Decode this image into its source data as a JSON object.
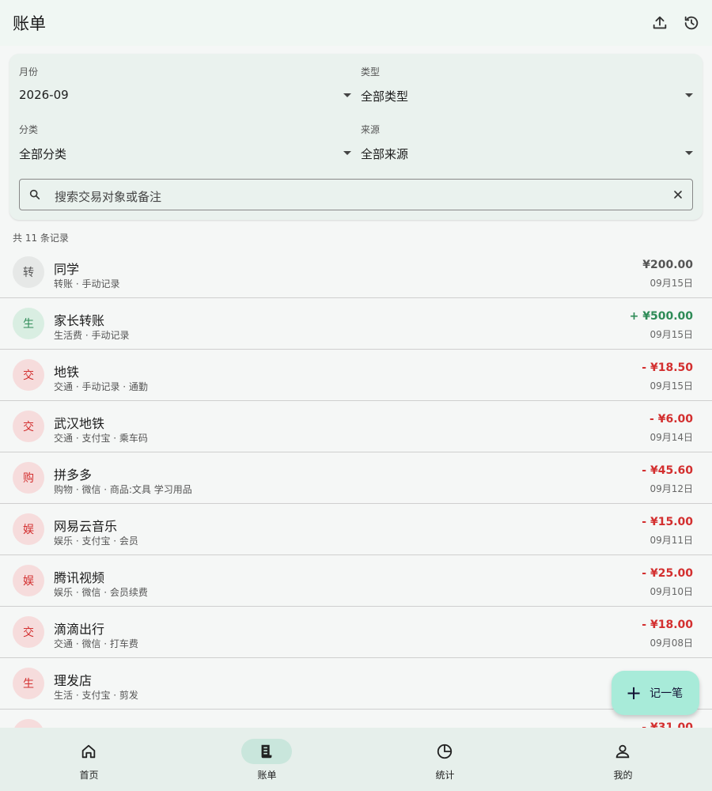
{
  "header": {
    "title": "账单",
    "actions": [
      {
        "icon": "upload-icon"
      },
      {
        "icon": "history-icon"
      }
    ]
  },
  "filters": {
    "month": {
      "label": "月份",
      "value": "2026-09"
    },
    "type": {
      "label": "类型",
      "value": "全部类型"
    },
    "category": {
      "label": "分类",
      "value": "全部分类"
    },
    "source": {
      "label": "来源",
      "value": "全部来源"
    },
    "search": {
      "placeholder": "搜索交易对象或备注"
    }
  },
  "record_count": "共 11 条记录",
  "colors": {
    "income": "#2e8b57",
    "expense": "#d32f2f",
    "neutral": "#555555",
    "accent": "#a8ebd9"
  },
  "transactions": [
    {
      "avatar": "转",
      "kind": "neutral",
      "name": "同学",
      "sub": "转账 · 手动记录",
      "amount": "¥200.00",
      "date": "09月15日"
    },
    {
      "avatar": "生",
      "kind": "income",
      "name": "家长转账",
      "sub": "生活费 · 手动记录",
      "amount": "+ ¥500.00",
      "date": "09月15日"
    },
    {
      "avatar": "交",
      "kind": "expense",
      "name": "地铁",
      "sub": "交通 · 手动记录 · 通勤",
      "amount": "- ¥18.50",
      "date": "09月15日"
    },
    {
      "avatar": "交",
      "kind": "expense",
      "name": "武汉地铁",
      "sub": "交通 · 支付宝 · 乘车码",
      "amount": "- ¥6.00",
      "date": "09月14日"
    },
    {
      "avatar": "购",
      "kind": "expense",
      "name": "拼多多",
      "sub": "购物 · 微信 · 商品:文具 学习用品",
      "amount": "- ¥45.60",
      "date": "09月12日"
    },
    {
      "avatar": "娱",
      "kind": "expense",
      "name": "网易云音乐",
      "sub": "娱乐 · 支付宝 · 会员",
      "amount": "- ¥15.00",
      "date": "09月11日"
    },
    {
      "avatar": "娱",
      "kind": "expense",
      "name": "腾讯视频",
      "sub": "娱乐 · 微信 · 会员续费",
      "amount": "- ¥25.00",
      "date": "09月10日"
    },
    {
      "avatar": "交",
      "kind": "expense",
      "name": "滴滴出行",
      "sub": "交通 · 微信 · 打车费",
      "amount": "- ¥18.00",
      "date": "09月08日"
    },
    {
      "avatar": "生",
      "kind": "expense",
      "name": "理发店",
      "sub": "生活 · 支付宝 · 剪发",
      "amount": "",
      "date": ""
    },
    {
      "avatar": "",
      "kind": "expense",
      "name": "",
      "sub": "",
      "amount": "- ¥31.00",
      "date": ""
    }
  ],
  "fab": {
    "icon": "plus-icon",
    "label": "记一笔"
  },
  "bottom_nav": [
    {
      "icon": "home-icon",
      "label": "首页",
      "active": false
    },
    {
      "icon": "receipt-icon",
      "label": "账单",
      "active": true
    },
    {
      "icon": "pie-chart-icon",
      "label": "统计",
      "active": false
    },
    {
      "icon": "person-icon",
      "label": "我的",
      "active": false
    }
  ]
}
